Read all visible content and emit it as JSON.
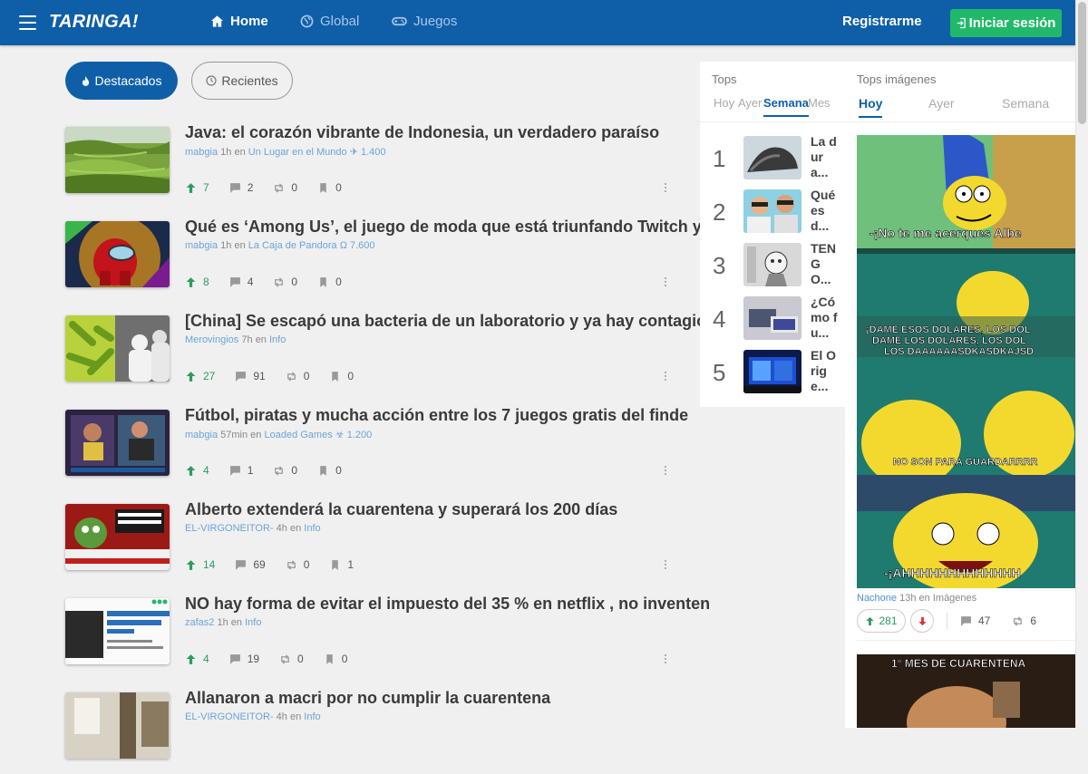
{
  "header": {
    "logo": "TARINGA!",
    "nav": [
      {
        "label": "Home",
        "icon": "home-icon"
      },
      {
        "label": "Global",
        "icon": "globe-icon"
      },
      {
        "label": "Juegos",
        "icon": "gamepad-icon"
      }
    ],
    "register_label": "Registrarme",
    "login_label": "Iniciar sesión",
    "colors": {
      "bar": "#0f5fa8",
      "login": "#21b969"
    }
  },
  "filters": {
    "featured": "Destacados",
    "recent": "Recientes"
  },
  "posts": [
    {
      "title": "Java: el corazón vibrante de Indonesia, un verdadero paraíso",
      "user": "mabgia",
      "time": "1h",
      "en": "en",
      "community": "Un Lugar en el Mundo",
      "community_icon": "✈",
      "members": "1.400",
      "votes": "7",
      "comments": "2",
      "shares": "0",
      "saves": "0"
    },
    {
      "title": "Qué es ‘Among Us’, el juego de moda que está triunfando Twitch y YT",
      "user": "mabgia",
      "time": "1h",
      "en": "en",
      "community": "La Caja de Pandora",
      "community_icon": "Ω",
      "members": "7.600",
      "votes": "8",
      "comments": "4",
      "shares": "0",
      "saves": "0"
    },
    {
      "title": "[China] Se escapó una bacteria de un laboratorio y ya hay contagios!",
      "user": "Merovingios",
      "time": "7h",
      "en": "en",
      "community": "Info",
      "community_icon": "",
      "members": "",
      "votes": "27",
      "comments": "91",
      "shares": "0",
      "saves": "0"
    },
    {
      "title": "Fútbol, piratas y mucha acción entre los 7 juegos gratis del finde",
      "user": "mabgia",
      "time": "57min",
      "en": "en",
      "community": "Loaded Games",
      "community_icon": "☣",
      "members": "1.200",
      "votes": "4",
      "comments": "1",
      "shares": "0",
      "saves": "0"
    },
    {
      "title": "Alberto extenderá la cuarentena y superará los 200 días",
      "user": "EL-VIRGONEITOR-",
      "time": "4h",
      "en": "en",
      "community": "Info",
      "community_icon": "",
      "members": "",
      "votes": "14",
      "comments": "69",
      "shares": "0",
      "saves": "1"
    },
    {
      "title": "NO hay forma de evitar el impuesto del 35 % en netflix , no inventen",
      "user": "zafas2",
      "time": "1h",
      "en": "en",
      "community": "Info",
      "community_icon": "",
      "members": "",
      "votes": "4",
      "comments": "19",
      "shares": "0",
      "saves": "0"
    },
    {
      "title": "Allanaron a macri por no cumplir la cuarentena",
      "user": "EL-VIRGONEITOR-",
      "time": "4h",
      "en": "en",
      "community": "Info",
      "community_icon": "",
      "members": "",
      "votes": "",
      "comments": "",
      "shares": "",
      "saves": ""
    }
  ],
  "tops": {
    "heading": "Tops",
    "tabs": [
      "Hoy",
      "Ayer",
      "Semana",
      "Mes"
    ],
    "active_tab": "Semana",
    "items": [
      {
        "rank": "1",
        "text": "La dura..."
      },
      {
        "rank": "2",
        "text": "Qué es d..."
      },
      {
        "rank": "3",
        "text": "TENGO..."
      },
      {
        "rank": "4",
        "text": "¿Cómo fu..."
      },
      {
        "rank": "5",
        "text": "El Orige..."
      }
    ]
  },
  "tops_images": {
    "heading": "Tops imágenes",
    "tabs": [
      "Hoy",
      "Ayer",
      "Semana"
    ],
    "active_tab": "Hoy",
    "image_captions": [
      "-¡No te me acerques Albe",
      "¡DAME ESOS DOLARES, LOS DOL",
      "DAME LOS DOLARES, LOS DOL",
      "LOS DAAAAAASDKASDKAJSD",
      "NO SON PARA GUARDARRRR",
      "-¡AHHHHHHHHHHHHH"
    ],
    "author": "Nachone",
    "time": "13h",
    "en": "en",
    "category": "Imágenes",
    "votes": "281",
    "comments": "47",
    "shares": "6",
    "second_caption": "1° MES DE CUARENTENA"
  }
}
